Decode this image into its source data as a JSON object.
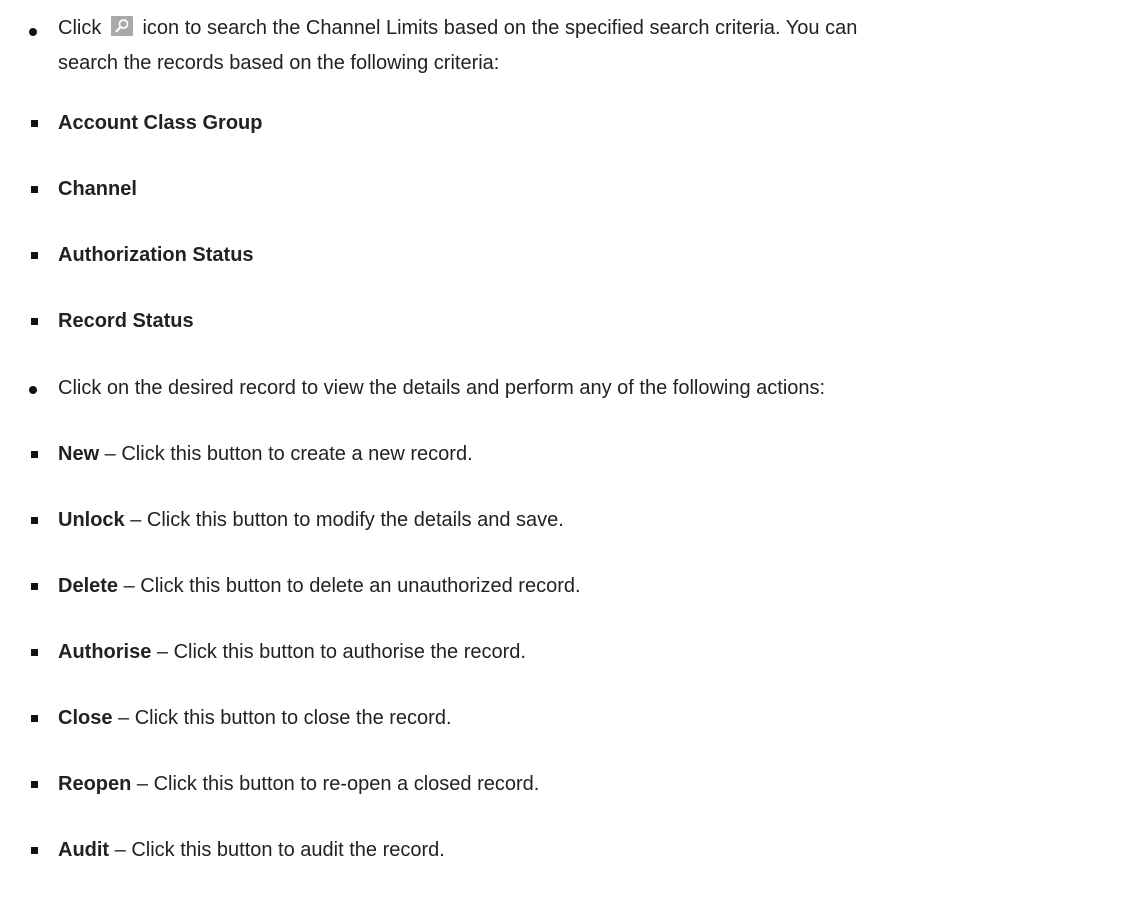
{
  "intro": {
    "prefix": "Click",
    "icon": "search-icon",
    "line1": "icon to search the Channel Limits based on the specified search criteria. You can",
    "line2": "search the records based on the following criteria:"
  },
  "criteria": [
    "Account Class Group",
    "Channel",
    "Authorization Status",
    "Record Status"
  ],
  "actions_intro": "Click on the desired record to view the details and perform any of the following actions:",
  "actions": [
    {
      "name": "New",
      "desc": " – Click this button to create a new record."
    },
    {
      "name": "Unlock",
      "desc": " – Click this button to modify the details and save."
    },
    {
      "name": "Delete",
      "desc": " – Click this button to delete an unauthorized record."
    },
    {
      "name": "Authorise",
      "desc": " – Click this button to authorise the record."
    },
    {
      "name": "Close",
      "desc": " – Click this button to close the record."
    },
    {
      "name": "Reopen",
      "desc": " – Click this button to re-open a closed record."
    },
    {
      "name": "Audit",
      "desc": " – Click this button to audit the record."
    }
  ]
}
